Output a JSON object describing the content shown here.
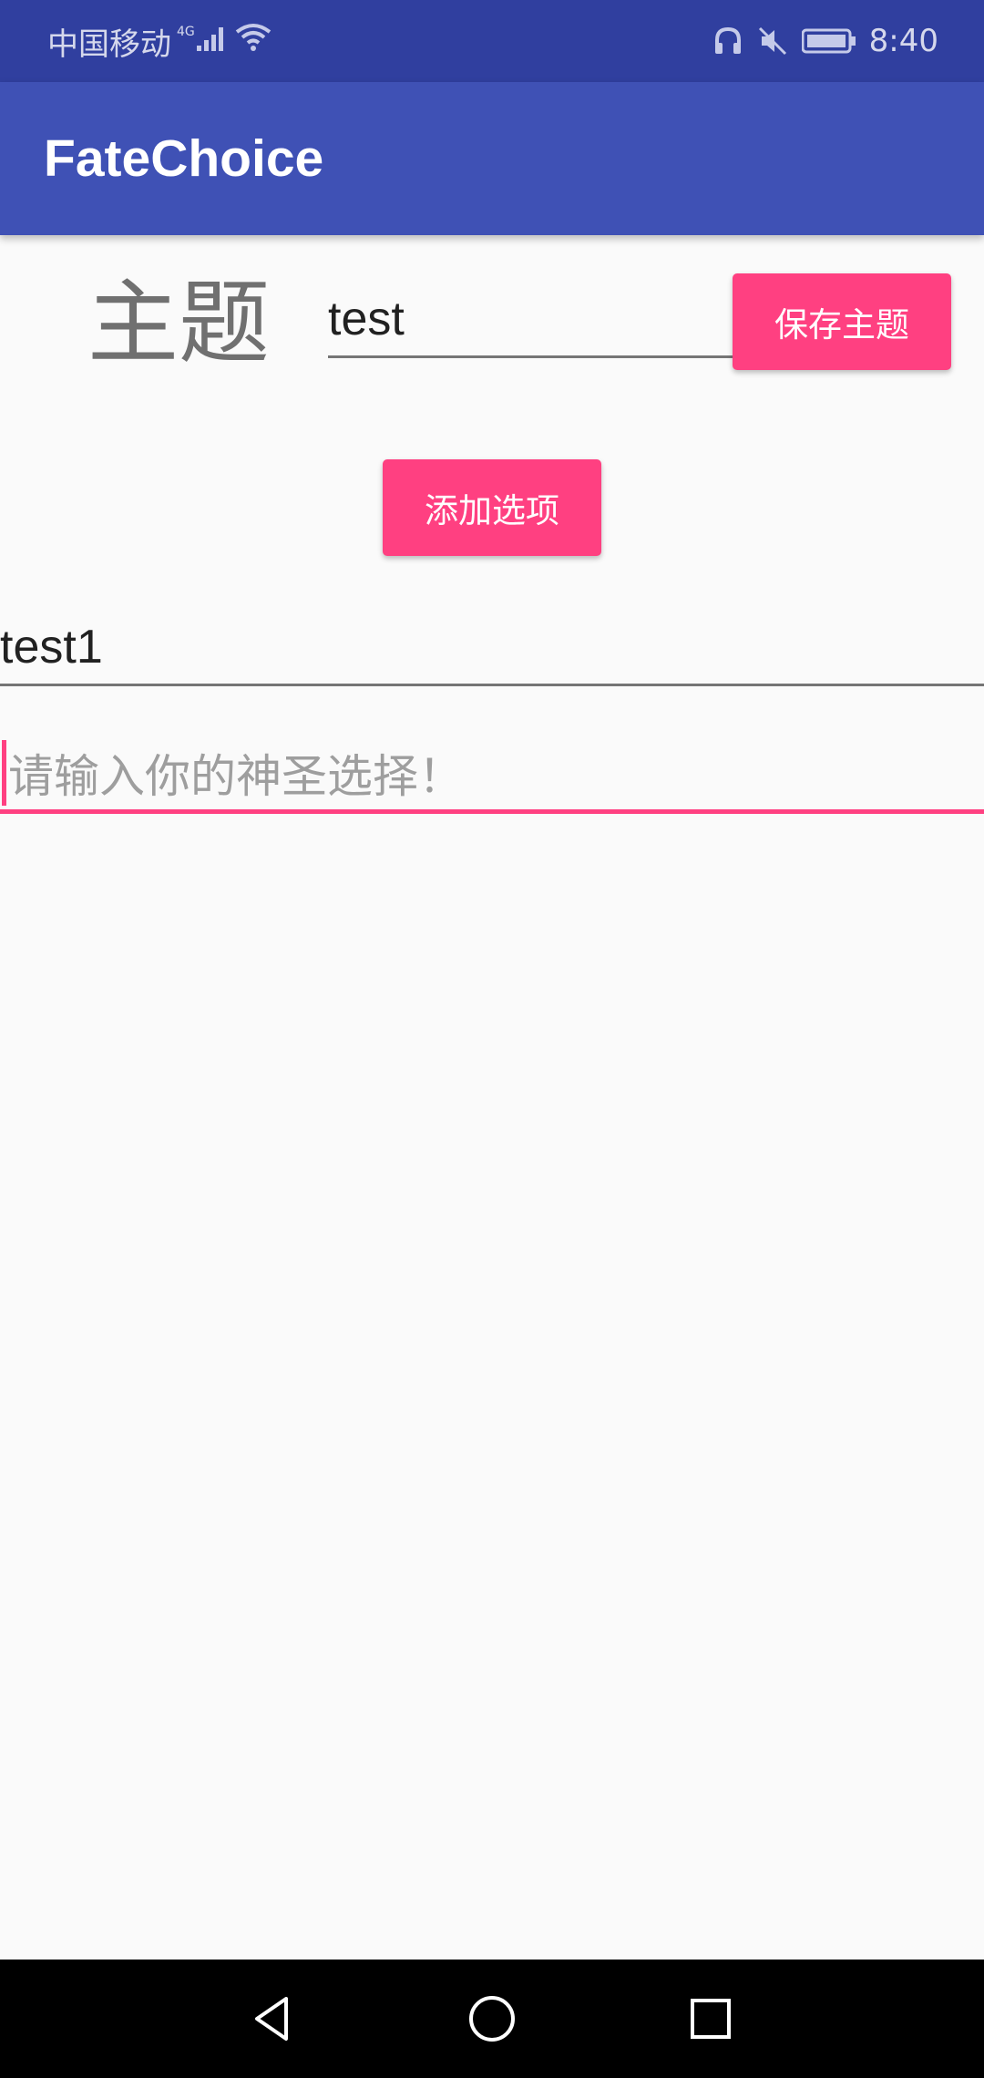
{
  "status_bar": {
    "carrier": "中国移动",
    "network": "4G",
    "time": "8:40",
    "icons": [
      "signal-icon",
      "wifi-icon",
      "headset-icon",
      "mute-icon",
      "battery-icon"
    ]
  },
  "app_bar": {
    "title": "FateChoice"
  },
  "theme": {
    "label": "主题",
    "value": "test",
    "save_button": "保存主题"
  },
  "add_button": "添加选项",
  "options": [
    "test1"
  ],
  "new_option": {
    "placeholder": "请输入你的神圣选择！"
  },
  "nav_bar": {
    "icons": [
      "back-icon",
      "home-icon",
      "recents-icon"
    ]
  },
  "colors": {
    "status_bar": "#303f9f",
    "primary": "#3f51b5",
    "accent": "#ff4081",
    "background": "#fafafa"
  }
}
